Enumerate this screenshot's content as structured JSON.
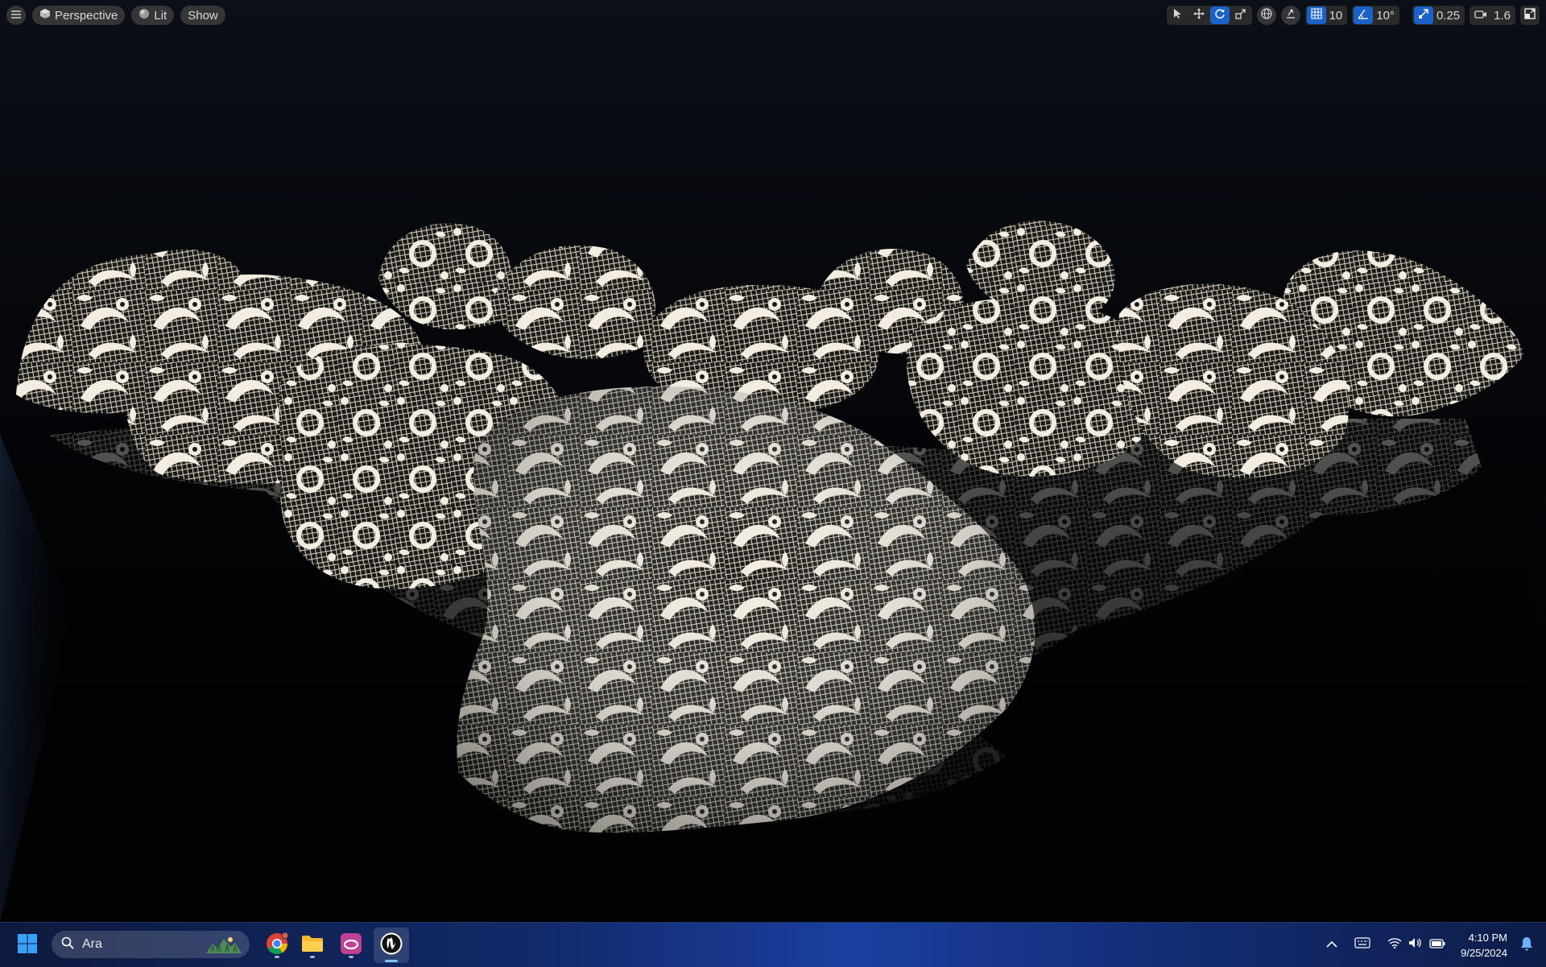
{
  "viewport": {
    "menu_icon": "hamburger-icon",
    "view_mode": {
      "label": "Perspective",
      "icon": "cube-icon"
    },
    "lighting_mode": {
      "label": "Lit",
      "icon": "sphere-icon"
    },
    "show_menu": {
      "label": "Show"
    },
    "transform_tools": [
      {
        "name": "select",
        "icon": "cursor-icon",
        "active": false
      },
      {
        "name": "translate",
        "icon": "move-icon",
        "active": false
      },
      {
        "name": "rotate",
        "icon": "rotate-icon",
        "active": true
      },
      {
        "name": "scale",
        "icon": "scale-icon",
        "active": false
      }
    ],
    "coordinate_space_icon": "globe-icon",
    "surface_snap_icon": "surface-snap-icon",
    "grid_snap": {
      "value": "10",
      "icon": "grid-icon",
      "active": true
    },
    "rotation_snap": {
      "value": "10°",
      "icon": "angle-icon",
      "active": true
    },
    "scale_snap": {
      "value": "0.25",
      "icon": "scale-snap-icon",
      "active": true
    },
    "camera_speed": {
      "value": "1.6",
      "icon": "camera-icon"
    },
    "maximize_icon": "maximize-viewport-icon"
  },
  "taskbar": {
    "start_icon": "windows-start-icon",
    "search": {
      "value": "Ara",
      "icon": "search-icon",
      "highlight_icon": "search-highlight-icon"
    },
    "apps": [
      {
        "name": "chrome",
        "icon": "chrome-icon",
        "running": true,
        "active": false
      },
      {
        "name": "file-explorer",
        "icon": "folder-icon",
        "running": true,
        "active": false
      },
      {
        "name": "creative-cloud",
        "icon": "creative-cloud-icon",
        "running": true,
        "active": false
      },
      {
        "name": "unreal-engine",
        "icon": "unreal-engine-icon",
        "running": true,
        "active": true
      }
    ],
    "tray": {
      "icons": [
        "chevron-up-icon",
        "keyboard-icon",
        "wifi-icon",
        "volume-icon",
        "battery-icon"
      ],
      "time": "4:10 PM",
      "date": "9/25/2024",
      "notification_icon": "bell-icon"
    }
  },
  "colors": {
    "accent_blue": "#1a62c7",
    "lace_white": "#efe8dc",
    "background": "#05070b"
  }
}
